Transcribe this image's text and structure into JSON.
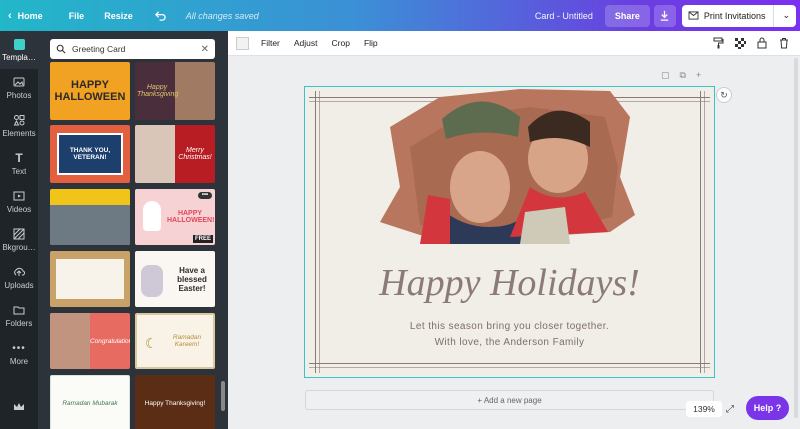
{
  "topbar": {
    "home": "Home",
    "file": "File",
    "resize": "Resize",
    "saved_status": "All changes saved",
    "doc_title": "Card - Untitled",
    "share": "Share",
    "print": "Print Invitations"
  },
  "nav": {
    "items": [
      {
        "label": "Templa…",
        "icon": "template-icon"
      },
      {
        "label": "Photos",
        "icon": "photo-icon"
      },
      {
        "label": "Elements",
        "icon": "elements-icon"
      },
      {
        "label": "Text",
        "icon": "text-icon"
      },
      {
        "label": "Videos",
        "icon": "video-icon"
      },
      {
        "label": "Bkgrou…",
        "icon": "background-icon"
      },
      {
        "label": "Uploads",
        "icon": "upload-icon"
      },
      {
        "label": "Folders",
        "icon": "folder-icon"
      },
      {
        "label": "More",
        "icon": "more-icon"
      }
    ]
  },
  "panel": {
    "search_value": "Greeting Card",
    "thumbs": [
      {
        "text": "HAPPY HALLOWEEN"
      },
      {
        "text": "Happy Thanksgiving"
      },
      {
        "text": "THANK YOU, VETERAN!"
      },
      {
        "text": "Merry Christmas!"
      },
      {
        "text": "HAPPY HALLOWEEN!"
      },
      {
        "text": "Have a blessed Easter!"
      },
      {
        "text": "Congratulations!"
      },
      {
        "text": "Ramadan Kareem!"
      },
      {
        "text": "Ramadan Mubarak"
      },
      {
        "text": "Happy Thanksgiving!"
      },
      {
        "text": ""
      },
      {
        "text": ""
      }
    ],
    "free_badge": "FREE"
  },
  "toolbar": {
    "filter": "Filter",
    "adjust": "Adjust",
    "crop": "Crop",
    "flip": "Flip"
  },
  "card": {
    "headline": "Happy Holidays!",
    "line1": "Let this season bring you closer together.",
    "line2": "With love, the Anderson Family"
  },
  "canvas": {
    "add_page": "+ Add a new page",
    "zoom": "139%",
    "help": "Help ?"
  },
  "colors": {
    "accent_purple": "#7a35e8",
    "card_bg": "#f1ede7",
    "headline": "#8c7a78",
    "selection": "#38c4cc"
  }
}
